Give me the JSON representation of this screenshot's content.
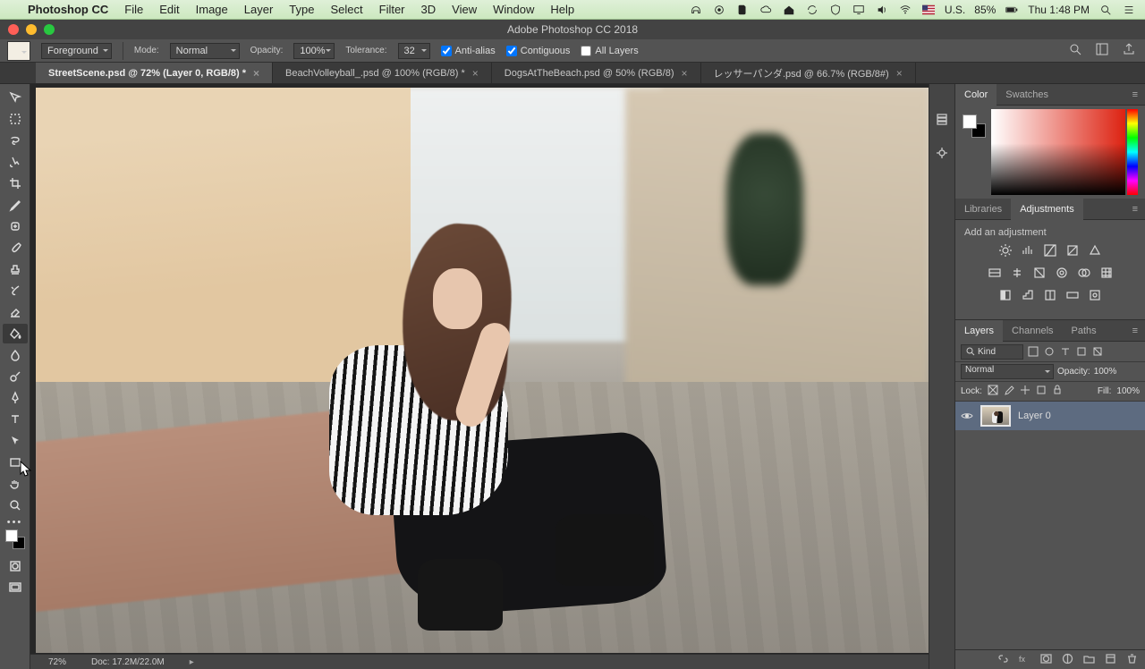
{
  "mac": {
    "app_name": "Photoshop CC",
    "menu": [
      "File",
      "Edit",
      "Image",
      "Layer",
      "Type",
      "Select",
      "Filter",
      "3D",
      "View",
      "Window",
      "Help"
    ],
    "battery": "85%",
    "input": "U.S.",
    "clock": "Thu 1:48 PM"
  },
  "titlebar": {
    "title": "Adobe Photoshop CC 2018"
  },
  "options": {
    "fill_area_label": "Foreground",
    "mode_label": "Mode:",
    "mode_value": "Normal",
    "opacity_label": "Opacity:",
    "opacity_value": "100%",
    "tolerance_label": "Tolerance:",
    "tolerance_value": "32",
    "antialias": "Anti-alias",
    "contiguous": "Contiguous",
    "all_layers": "All Layers"
  },
  "tabs": [
    {
      "label": "StreetScene.psd @ 72% (Layer 0, RGB/8) *",
      "active": true
    },
    {
      "label": "BeachVolleyball_.psd @ 100% (RGB/8) *",
      "active": false
    },
    {
      "label": "DogsAtTheBeach.psd @ 50% (RGB/8)",
      "active": false
    },
    {
      "label": "レッサーパンダ.psd @ 66.7% (RGB/8#)",
      "active": false
    }
  ],
  "status": {
    "zoom": "72%",
    "doc": "Doc: 17.2M/22.0M"
  },
  "panels": {
    "color_tabs": [
      "Color",
      "Swatches"
    ],
    "lib_tabs": [
      "Libraries",
      "Adjustments"
    ],
    "adj_label": "Add an adjustment",
    "layer_tabs": [
      "Layers",
      "Channels",
      "Paths"
    ],
    "layers": {
      "kind_label": "Kind",
      "blend_mode": "Normal",
      "opacity_label": "Opacity:",
      "opacity_value": "100%",
      "lock_label": "Lock:",
      "fill_label": "Fill:",
      "fill_value": "100%",
      "items": [
        {
          "name": "Layer 0"
        }
      ]
    }
  },
  "tools": [
    "move",
    "marquee",
    "lasso",
    "quick-select",
    "crop",
    "eyedropper",
    "healing",
    "brush",
    "stamp",
    "history-brush",
    "eraser",
    "gradient",
    "paint-bucket",
    "blur",
    "dodge",
    "pen",
    "type",
    "path-select",
    "rectangle",
    "hand",
    "zoom"
  ]
}
